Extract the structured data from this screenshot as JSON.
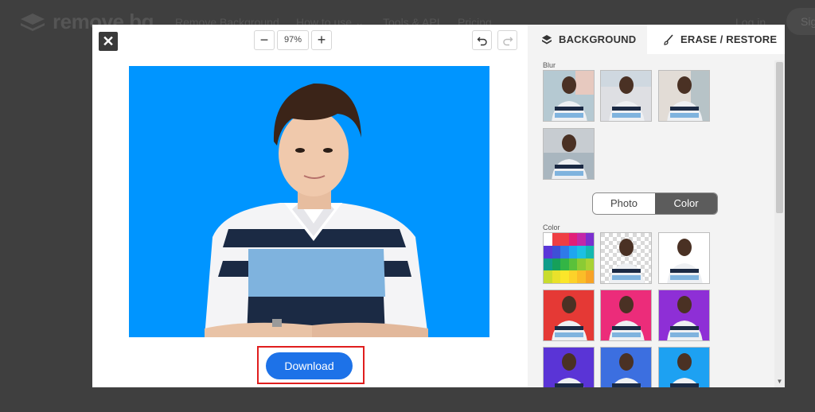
{
  "site": {
    "logo_text": "remove bg",
    "nav": [
      "Remove Background",
      "How to use ⌄",
      "Tools & API",
      "Pricing",
      "Log in",
      "Sig"
    ]
  },
  "editor": {
    "close_icon": "close-icon",
    "zoom": {
      "minus_label": "−",
      "value": "97%",
      "plus_label": "+"
    },
    "undo_icon": "undo-icon",
    "redo_icon": "redo-icon",
    "download_label": "Download"
  },
  "sidebar": {
    "tabs": [
      {
        "label": "BACKGROUND",
        "icon": "layers-icon",
        "active": true
      },
      {
        "label": "ERASE / RESTORE",
        "icon": "brush-icon",
        "active": false
      }
    ],
    "blur_label": "Blur",
    "toggle": {
      "photo": "Photo",
      "color": "Color",
      "selected": "Color"
    },
    "color_label": "Color",
    "swatch_colors": [
      "#ffffff",
      "#e53935",
      "#ec2c7a",
      "#8e2fd6",
      "#5a34d6",
      "#3c6fe0",
      "#1da1f2"
    ]
  },
  "colors": {
    "canvas_background": "#0095ff",
    "download_button": "#1d72e8",
    "highlight": "#e01e1e"
  }
}
